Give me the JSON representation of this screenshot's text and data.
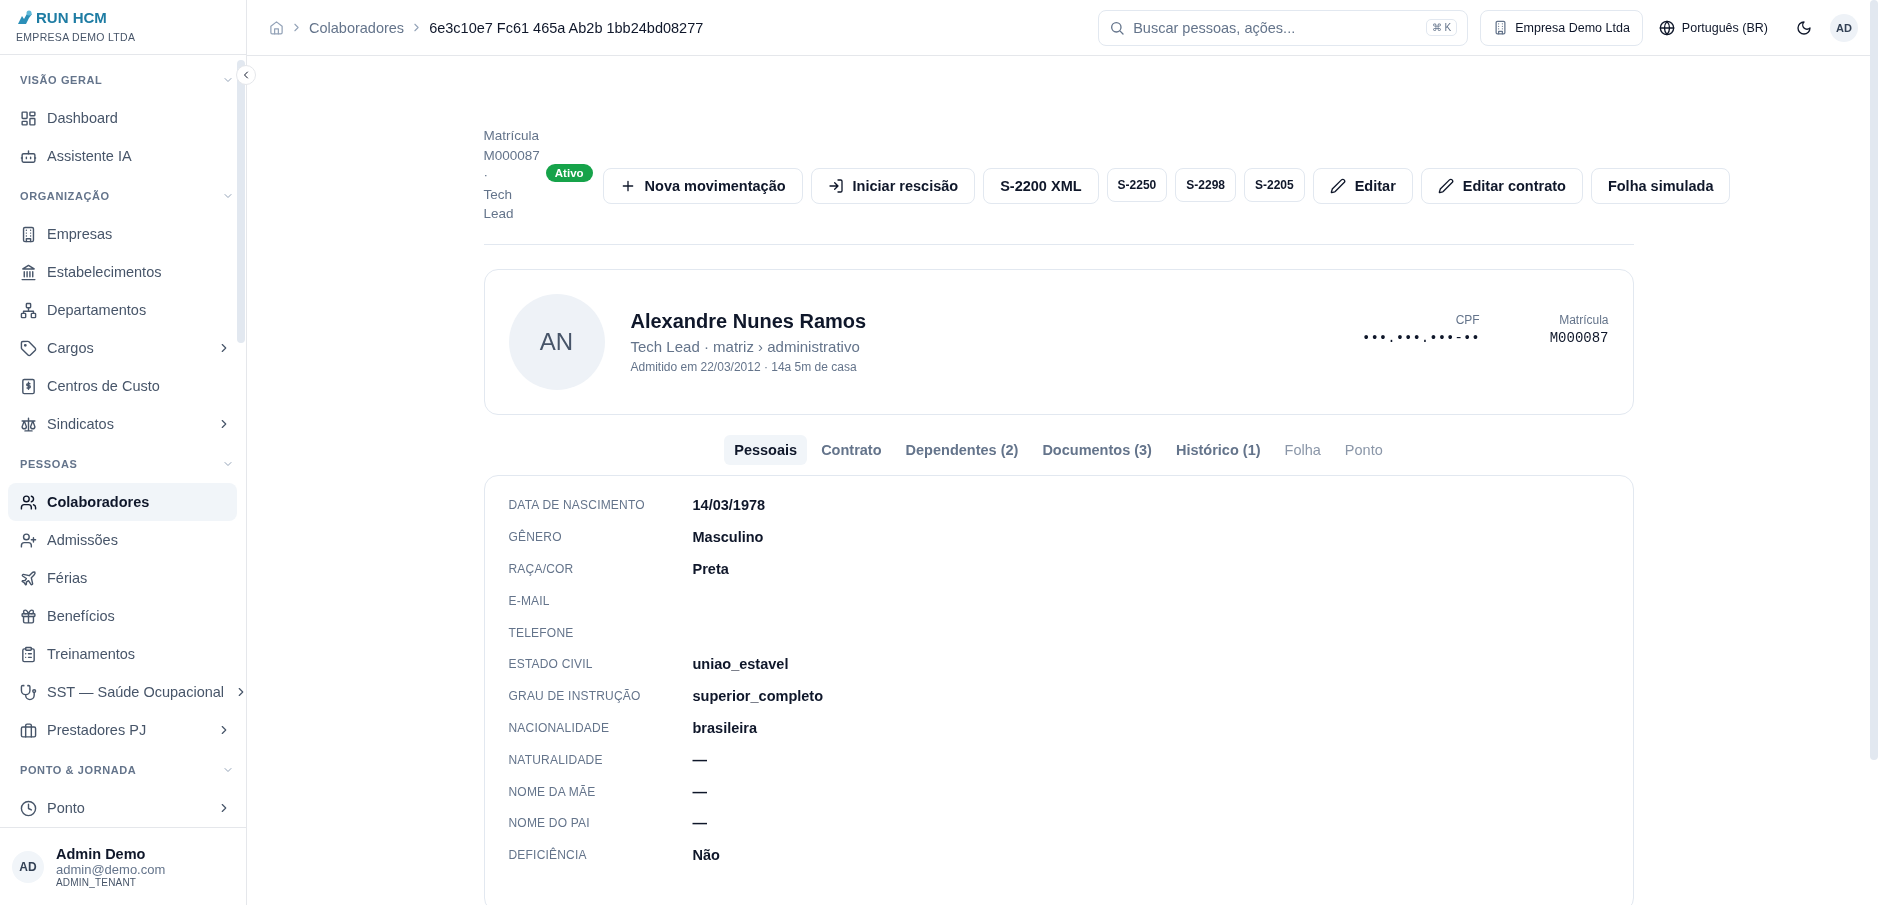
{
  "brand": {
    "name": "RUN HCM",
    "company": "EMPRESA DEMO LTDA"
  },
  "sidebar": {
    "sections": [
      {
        "title": "VISÃO GERAL",
        "expanded": true,
        "items": [
          {
            "label": "Dashboard",
            "has_submenu": false,
            "selected": false
          },
          {
            "label": "Assistente IA",
            "has_submenu": false,
            "selected": false
          }
        ]
      },
      {
        "title": "ORGANIZAÇÃO",
        "expanded": true,
        "items": [
          {
            "label": "Empresas",
            "has_submenu": false,
            "selected": false
          },
          {
            "label": "Estabelecimentos",
            "has_submenu": false,
            "selected": false
          },
          {
            "label": "Departamentos",
            "has_submenu": false,
            "selected": false
          },
          {
            "label": "Cargos",
            "has_submenu": true,
            "selected": false
          },
          {
            "label": "Centros de Custo",
            "has_submenu": false,
            "selected": false
          },
          {
            "label": "Sindicatos",
            "has_submenu": true,
            "selected": false
          }
        ]
      },
      {
        "title": "PESSOAS",
        "expanded": true,
        "items": [
          {
            "label": "Colaboradores",
            "has_submenu": false,
            "selected": true
          },
          {
            "label": "Admissões",
            "has_submenu": false,
            "selected": false
          },
          {
            "label": "Férias",
            "has_submenu": false,
            "selected": false
          },
          {
            "label": "Benefícios",
            "has_submenu": false,
            "selected": false
          },
          {
            "label": "Treinamentos",
            "has_submenu": false,
            "selected": false
          },
          {
            "label": "SST — Saúde Ocupacional",
            "has_submenu": true,
            "selected": false
          },
          {
            "label": "Prestadores PJ",
            "has_submenu": true,
            "selected": false
          }
        ]
      },
      {
        "title": "PONTO & JORNADA",
        "expanded": true,
        "items": [
          {
            "label": "Ponto",
            "has_submenu": true,
            "selected": false
          }
        ]
      }
    ]
  },
  "user": {
    "initials": "AD",
    "name": "Admin Demo",
    "email": "admin@demo.com",
    "role": "ADMIN_TENANT"
  },
  "topbar": {
    "breadcrumbs": [
      "Colaboradores",
      "6e3c10e7 Fc61 465a Ab2b 1bb24bd08277"
    ],
    "search": {
      "placeholder": "Buscar pessoas, ações...",
      "shortcut": "⌘ K"
    },
    "company": "Empresa Demo Ltda",
    "language": "Português (BR)",
    "avatar": "AD"
  },
  "header": {
    "subtitle_lines": [
      "Matrícula",
      "M000087",
      "·",
      "Tech",
      "Lead"
    ],
    "status": "Ativo",
    "actions": [
      {
        "label": "Nova movimentação",
        "kind": "plus"
      },
      {
        "label": "Iniciar rescisão",
        "kind": "exit"
      },
      {
        "label": "S-2200 XML",
        "kind": "plain"
      },
      {
        "label": "S-2250",
        "kind": "small"
      },
      {
        "label": "S-2298",
        "kind": "small"
      },
      {
        "label": "S-2205",
        "kind": "small"
      },
      {
        "label": "Editar",
        "kind": "pencil"
      },
      {
        "label": "Editar contrato",
        "kind": "pencil"
      },
      {
        "label": "Folha simulada",
        "kind": "plain"
      }
    ]
  },
  "profile": {
    "initials": "AN",
    "name": "Alexandre Nunes Ramos",
    "subtitle": "Tech Lead · matriz › administrativo",
    "admission": "Admitido em 22/03/2012 · 14a 5m de casa",
    "stats": [
      {
        "label": "CPF",
        "value": "•••.•••.•••-••"
      },
      {
        "label": "Matrícula",
        "value": "M000087"
      }
    ]
  },
  "tabs": [
    {
      "label": "Pessoais",
      "selected": true,
      "disabled": false
    },
    {
      "label": "Contrato",
      "selected": false,
      "disabled": false
    },
    {
      "label": "Dependentes (2)",
      "selected": false,
      "disabled": false
    },
    {
      "label": "Documentos (3)",
      "selected": false,
      "disabled": false
    },
    {
      "label": "Histórico (1)",
      "selected": false,
      "disabled": false
    },
    {
      "label": "Folha",
      "selected": false,
      "disabled": true
    },
    {
      "label": "Ponto",
      "selected": false,
      "disabled": true
    }
  ],
  "fields": [
    {
      "label": "DATA DE NASCIMENTO",
      "value": "14/03/1978"
    },
    {
      "label": "GÊNERO",
      "value": "Masculino"
    },
    {
      "label": "RAÇA/COR",
      "value": "Preta"
    },
    {
      "label": "E-MAIL"
    },
    {
      "label": "TELEFONE"
    },
    {
      "label": "ESTADO CIVIL",
      "value": "uniao_estavel"
    },
    {
      "label": "GRAU DE INSTRUÇÃO",
      "value": "superior_completo"
    },
    {
      "label": "NACIONALIDADE",
      "value": "brasileira"
    },
    {
      "label": "NATURALIDADE",
      "value": "—"
    },
    {
      "label": "NOME DA MÃE",
      "value": "—"
    },
    {
      "label": "NOME DO PAI",
      "value": "—"
    },
    {
      "label": "DEFICIÊNCIA",
      "value": "Não"
    }
  ]
}
